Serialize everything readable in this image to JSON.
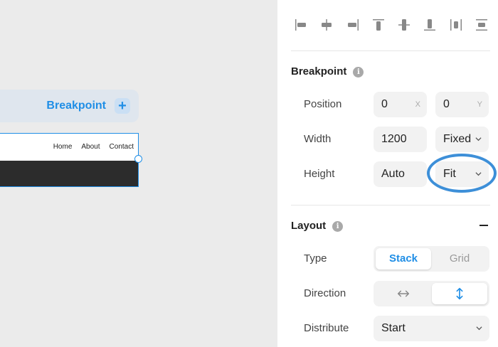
{
  "canvas": {
    "breakpoint_label": "Breakpoint",
    "plus_symbol": "+",
    "nav": [
      "Home",
      "About",
      "Contact"
    ]
  },
  "panel": {
    "alignment_icons": [
      "align-left-icon",
      "align-center-h-icon",
      "align-right-icon",
      "align-top-icon",
      "align-center-v-icon",
      "align-bottom-icon",
      "distribute-h-icon",
      "distribute-v-icon"
    ],
    "breakpoint": {
      "title": "Breakpoint",
      "info_symbol": "i",
      "position_label": "Position",
      "position_x": "0",
      "position_x_axis": "X",
      "position_y": "0",
      "position_y_axis": "Y",
      "width_label": "Width",
      "width_value": "1200",
      "width_mode": "Fixed",
      "height_label": "Height",
      "height_value": "Auto",
      "height_mode": "Fit"
    },
    "layout": {
      "title": "Layout",
      "info_symbol": "i",
      "type_label": "Type",
      "type_options": [
        "Stack",
        "Grid"
      ],
      "type_selected": "Stack",
      "direction_label": "Direction",
      "direction_options": [
        "horizontal-arrow-icon",
        "vertical-arrow-icon"
      ],
      "direction_selected": "vertical",
      "distribute_label": "Distribute",
      "distribute_value": "Start"
    },
    "accent_color": "#1f8ee6",
    "highlight_color": "#3d8fd8"
  }
}
